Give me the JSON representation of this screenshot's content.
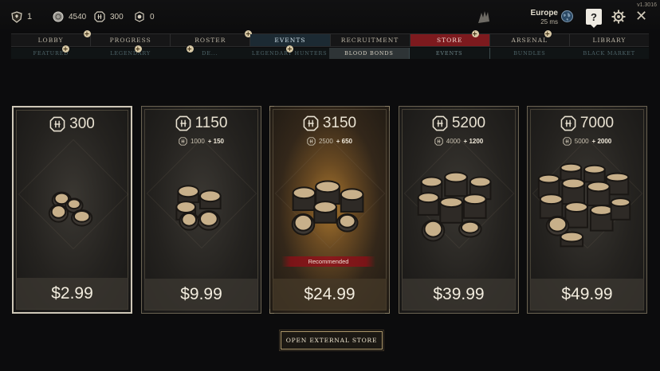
{
  "topbar": {
    "level": "1",
    "silver": "4540",
    "gold": "300",
    "tokens": "0",
    "region_name": "Europe",
    "region_ping": "25 ms",
    "help_label": "?",
    "close_label": "✕",
    "version": "v1.3016"
  },
  "mainnav": {
    "tabs": [
      {
        "label": "LOBBY"
      },
      {
        "label": "PROGRESS"
      },
      {
        "label": "ROSTER"
      },
      {
        "label": "EVENTS"
      },
      {
        "label": "RECRUITMENT"
      },
      {
        "label": "STORE"
      },
      {
        "label": "ARSENAL"
      },
      {
        "label": "LIBRARY"
      }
    ],
    "active": "STORE"
  },
  "subnav": {
    "tabs": [
      {
        "label": "FEATURED"
      },
      {
        "label": "LEGENDARY"
      },
      {
        "label": "DE..."
      },
      {
        "label": "LEGENDARY HUNTERS"
      },
      {
        "label": "BLOOD BONDS"
      },
      {
        "label": "EVENTS"
      },
      {
        "label": "BUNDLES"
      },
      {
        "label": "BLACK MARKET"
      }
    ],
    "active": "BLOOD BONDS"
  },
  "store": {
    "offers": [
      {
        "amount": "300",
        "base": "",
        "bonus": "",
        "price": "$2.99"
      },
      {
        "amount": "1150",
        "base": "1000",
        "bonus": "+ 150",
        "price": "$9.99"
      },
      {
        "amount": "3150",
        "base": "2500",
        "bonus": "+ 650",
        "price": "$24.99",
        "tag": "Recommended"
      },
      {
        "amount": "5200",
        "base": "4000",
        "bonus": "+ 1200",
        "price": "$39.99"
      },
      {
        "amount": "7000",
        "base": "5000",
        "bonus": "+ 2000",
        "price": "$49.99"
      }
    ],
    "external_store_label": "OPEN EXTERNAL STORE"
  },
  "colors": {
    "store_tab": "#7d1a1e",
    "events_tab": "#1c2a33",
    "accent_gold": "#b09a6b",
    "recommended_ribbon": "#8a1a1c"
  },
  "icons": {
    "level": "shield-icon",
    "silver": "silver-coin-icon",
    "gold": "blood-bond-icon",
    "tokens": "gear-token-icon",
    "emblem": "claw-emblem-icon",
    "globe": "globe-icon",
    "settings": "gear-icon",
    "close": "close-icon"
  }
}
